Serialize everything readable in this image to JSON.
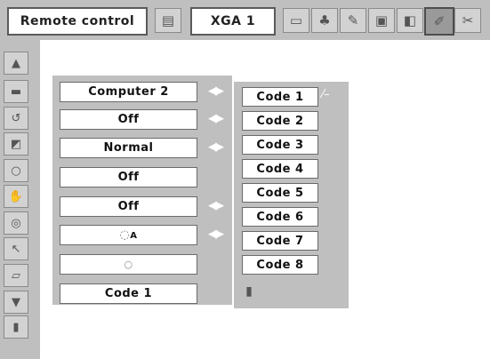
{
  "header": {
    "title": "Remote control",
    "input_signal": "XGA 1"
  },
  "toolbar": {
    "icons": [
      "input-icon",
      "pc-adjust-icon",
      "image-select-icon",
      "image-adjust-icon",
      "screen-icon",
      "setting-icon",
      "expand-icon",
      "info-icon"
    ],
    "active": "expand-icon"
  },
  "sidebar": {
    "icons": [
      "up-arrow-icon",
      "language-icon",
      "auto-setup-icon",
      "keystone-icon",
      "lamp-icon",
      "fan-icon",
      "power-management-icon",
      "pointer-icon",
      "remote-control-icon",
      "down-arrow-icon",
      "exit-icon"
    ]
  },
  "settings": {
    "rows": [
      {
        "value": "Computer 2",
        "has_arrows": true
      },
      {
        "value": "Off",
        "has_arrows": true
      },
      {
        "value": "Normal",
        "has_arrows": true
      },
      {
        "value": "Off",
        "has_arrows": false
      },
      {
        "value": "Off",
        "has_arrows": true
      },
      {
        "value": "lamp-A-icon",
        "has_arrows": true
      },
      {
        "value": "clock-icon",
        "has_arrows": false
      },
      {
        "value": "Code 1",
        "has_arrows": false
      }
    ],
    "arrow_glyph": "◀▶"
  },
  "codes": {
    "items": [
      "Code 1",
      "Code 2",
      "Code 3",
      "Code 4",
      "Code 5",
      "Code 6",
      "Code 7",
      "Code 8"
    ],
    "selected": "Code 1",
    "exit_icon": "exit-icon"
  },
  "colors": {
    "panel_gray": "#bfbfbf",
    "field_white": "#ffffff",
    "border": "#6a6a6a"
  }
}
